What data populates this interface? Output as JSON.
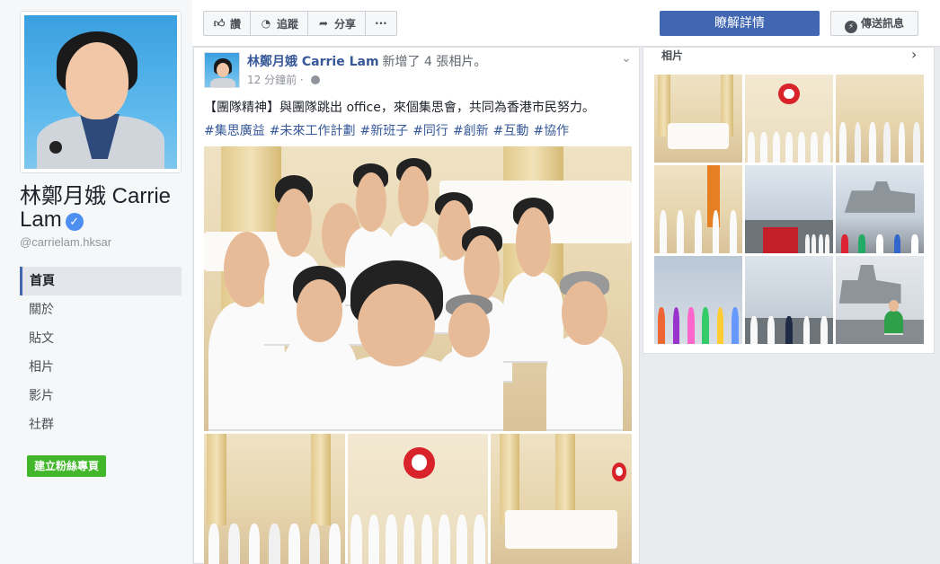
{
  "page": {
    "name": "林鄭月娥 Carrie Lam",
    "handle": "@carrielam.hksar",
    "verified": true
  },
  "nav": {
    "items": [
      {
        "label": "首頁",
        "active": true
      },
      {
        "label": "關於",
        "active": false
      },
      {
        "label": "貼文",
        "active": false
      },
      {
        "label": "相片",
        "active": false
      },
      {
        "label": "影片",
        "active": false
      },
      {
        "label": "社群",
        "active": false
      }
    ],
    "create_page_button": "建立粉絲專頁"
  },
  "toolbar": {
    "like": {
      "label": "讚",
      "icon": "thumbs-up-icon"
    },
    "follow": {
      "label": "追蹤",
      "icon": "rss-icon"
    },
    "share": {
      "label": "分享",
      "icon": "share-arrow-icon"
    },
    "more": {
      "label": "···"
    },
    "learn_more": "瞭解詳情",
    "send_message": {
      "label": "傳送訊息",
      "icon": "messenger-icon"
    }
  },
  "post": {
    "author": "林鄭月娥 Carrie Lam",
    "action": "新增了 4 張相片。",
    "time": "12 分鐘前",
    "privacy_icon": "globe-icon",
    "text": "【團隊精神】與團隊跳出 office，來個集思會，共同為香港市民努力。",
    "hashtags": [
      "#集思廣益",
      "#未來工作計劃",
      "#新班子",
      "#同行",
      "#創新",
      "#互動",
      "#協作"
    ]
  },
  "photos_panel": {
    "title": "相片",
    "arrow_icon": "chevron-right-icon"
  },
  "colors": {
    "brand_blue": "#4267b2",
    "link_blue": "#365899",
    "green": "#42b72a",
    "verified_blue": "#4d8ff1",
    "emblem_red": "#d8232a"
  }
}
